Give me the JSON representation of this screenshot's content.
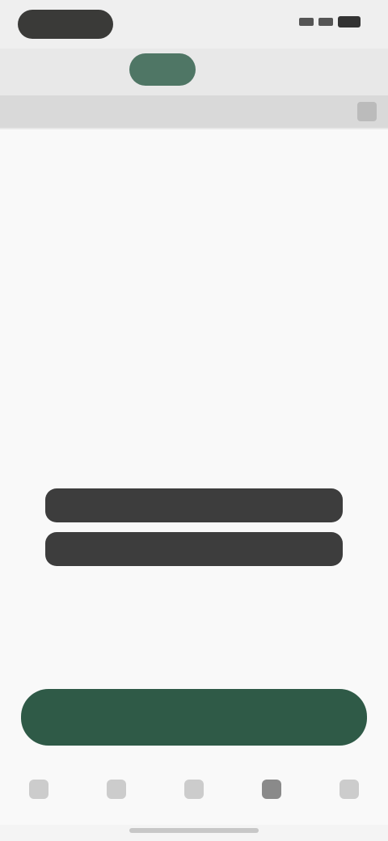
{
  "status_bar": {
    "time": ""
  },
  "app": {
    "title": ""
  },
  "tabs": {
    "left": "",
    "active": "",
    "right_icon": "menu-icon"
  },
  "main": {
    "heading": "",
    "paragraph_part1": "",
    "paragraph_link": "",
    "paragraph_part2": ""
  },
  "actions": {
    "primary_label": "",
    "secondary_label": "",
    "text_link": "",
    "small_label": ""
  },
  "cta": {
    "label": ""
  },
  "nav": {
    "items": [
      {
        "icon": "home-icon"
      },
      {
        "icon": "search-icon"
      },
      {
        "icon": "list-icon"
      },
      {
        "icon": "profile-icon"
      },
      {
        "icon": "settings-icon"
      }
    ]
  },
  "colors": {
    "accent": "#2f5a47",
    "logo": "#4f7665",
    "dark_button": "#3d3d3d",
    "background": "#f9f9f9"
  }
}
